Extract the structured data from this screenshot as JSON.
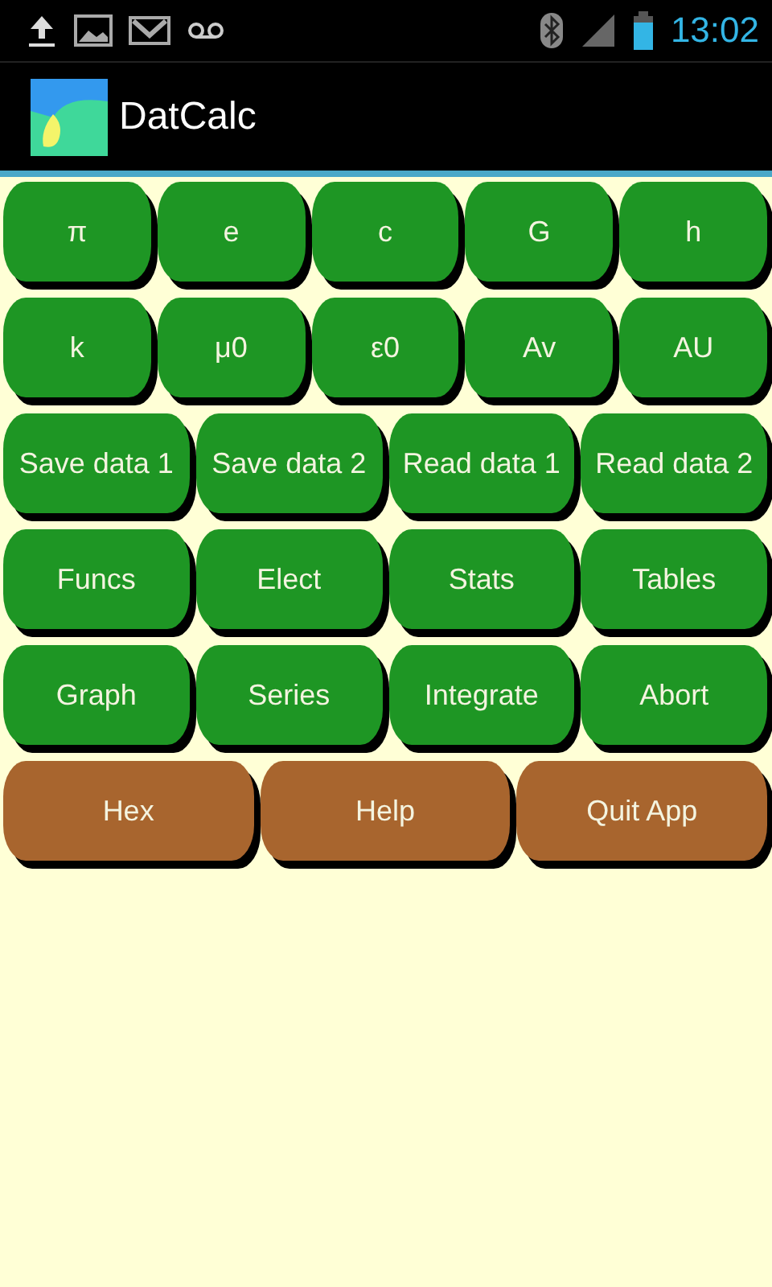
{
  "status_bar": {
    "time": "13:02"
  },
  "app_bar": {
    "title": "DatCalc"
  },
  "rows": [
    {
      "kind": "green",
      "buttons": [
        "π",
        "e",
        "c",
        "G",
        "h"
      ]
    },
    {
      "kind": "green",
      "buttons": [
        "k",
        "μ0",
        "ε0",
        "Av",
        "AU"
      ]
    },
    {
      "kind": "green",
      "buttons": [
        "Save data 1",
        "Save data 2",
        "Read data 1",
        "Read data 2"
      ]
    },
    {
      "kind": "green",
      "buttons": [
        "Funcs",
        "Elect",
        "Stats",
        "Tables"
      ]
    },
    {
      "kind": "green",
      "buttons": [
        "Graph",
        "Series",
        "Integrate",
        "Abort"
      ]
    },
    {
      "kind": "brown",
      "buttons": [
        "Hex",
        "Help",
        "Quit App"
      ]
    }
  ]
}
